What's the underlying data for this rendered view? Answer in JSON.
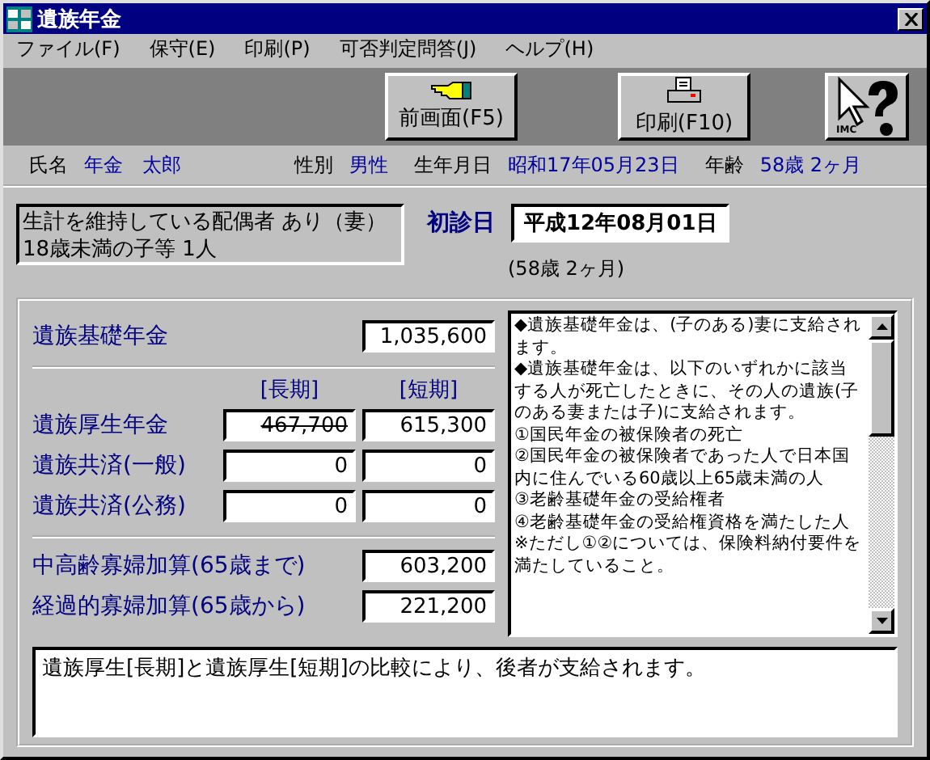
{
  "window": {
    "title": "遺族年金"
  },
  "menu": [
    "ファイル(F)",
    "保守(E)",
    "印刷(P)",
    "可否判定問答(J)",
    "ヘルプ(H)"
  ],
  "toolbar": [
    {
      "kind": "back",
      "label": "前画面(F5)"
    },
    {
      "kind": "print",
      "label": "印刷(F10)"
    },
    {
      "kind": "help",
      "label": "IMC"
    }
  ],
  "person": [
    {
      "label": "氏名",
      "value": "年金　太郎"
    },
    {
      "label": "性別",
      "value": "男性"
    },
    {
      "label": "生年月日",
      "value": "昭和17年05月23日"
    },
    {
      "label": "年齢",
      "value": "58歳 2ヶ月"
    }
  ],
  "household": [
    "生計を維持している配偶者 あり（妻）",
    "18歳未満の子等 1人"
  ],
  "first_exam": {
    "label": "初診日",
    "value": "平成12年08月01日",
    "elapsed": "(58歳 2ヶ月)"
  },
  "basic": {
    "label": "遺族基礎年金",
    "value": "1,035,600"
  },
  "columns": [
    "[長期]",
    "[短期]"
  ],
  "rows": [
    {
      "label": "遺族厚生年金",
      "values": [
        {
          "text": "467,700",
          "struck": true
        },
        {
          "text": "615,300",
          "struck": false
        }
      ]
    },
    {
      "label": "遺族共済(一般)",
      "values": [
        {
          "text": "0",
          "struck": false
        },
        {
          "text": "0",
          "struck": false
        }
      ]
    },
    {
      "label": "遺族共済(公務)",
      "values": [
        {
          "text": "0",
          "struck": false
        },
        {
          "text": "0",
          "struck": false
        }
      ]
    }
  ],
  "additions": [
    {
      "label": "中高齢寡婦加算(65歳まで)",
      "value": "603,200"
    },
    {
      "label": "経過的寡婦加算(65歳から)",
      "value": "221,200"
    }
  ],
  "explanation": [
    "◆遺族基礎年金は、(子のある)妻に支給されます。",
    "◆遺族基礎年金は、以下のいずれかに該当する人が死亡したときに、その人の遺族(子のある妻または子)に支給されます。",
    "①国民年金の被保険者の死亡",
    "②国民年金の被保険者であった人で日本国内に住んでいる60歳以上65歳未満の人",
    "③老齢基礎年金の受給権者",
    "④老齢基礎年金の受給権資格を満たした人",
    "※ただし①②については、保険料納付要件を満たしていること。"
  ],
  "message": "遺族厚生[長期]と遺族厚生[短期]の比較により、後者が支給されます。"
}
